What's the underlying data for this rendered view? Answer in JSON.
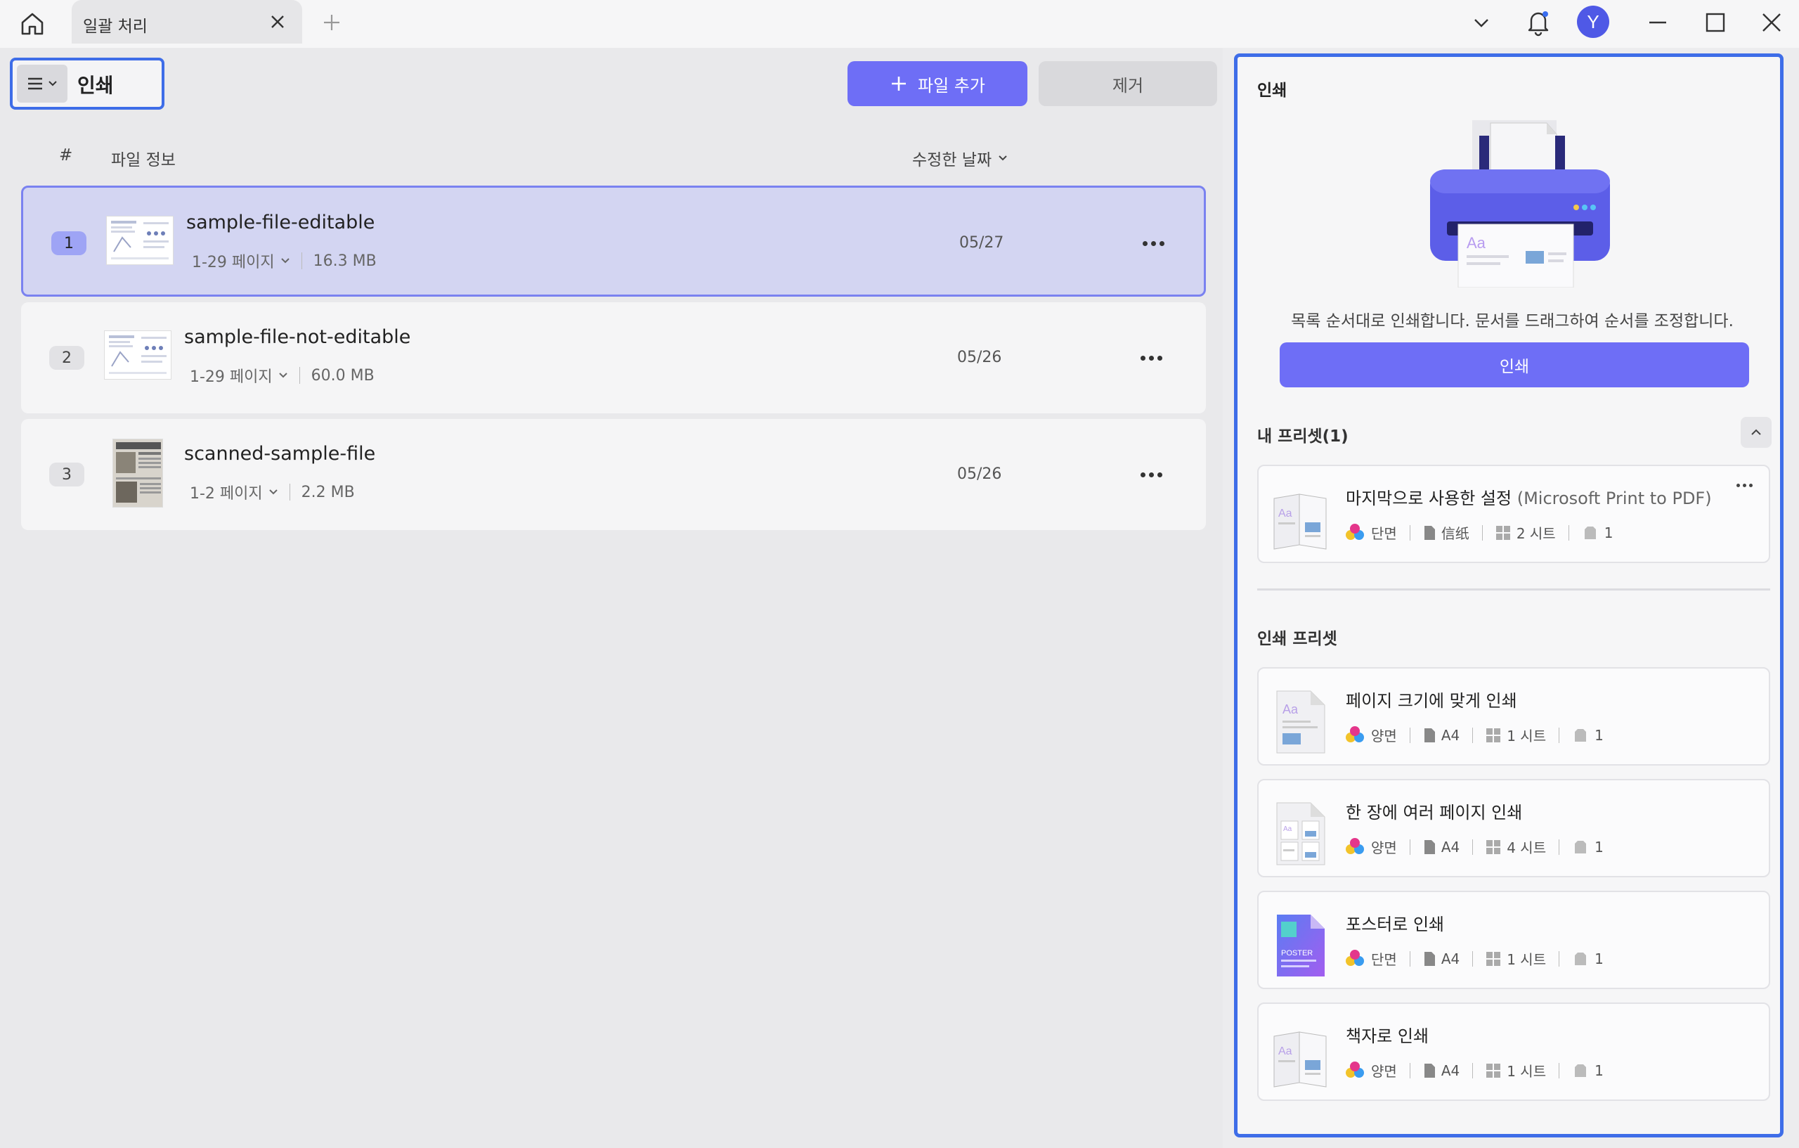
{
  "titlebar": {
    "tab_title": "일괄 처리",
    "avatar_letter": "Y"
  },
  "toolbar": {
    "mode_label": "인쇄",
    "add_file_label": "파일 추가",
    "remove_label": "제거"
  },
  "columns": {
    "number": "#",
    "file_info": "파일 정보",
    "modified_date": "수정한 날짜"
  },
  "files": [
    {
      "num": "1",
      "name": "sample-file-editable",
      "pages": "1-29 페이지",
      "size": "16.3 MB",
      "date": "05/27",
      "selected": true
    },
    {
      "num": "2",
      "name": "sample-file-not-editable",
      "pages": "1-29 페이지",
      "size": "60.0 MB",
      "date": "05/26",
      "selected": false
    },
    {
      "num": "3",
      "name": "scanned-sample-file",
      "pages": "1-2 페이지",
      "size": "2.2 MB",
      "date": "05/26",
      "selected": false
    }
  ],
  "print_panel": {
    "title": "인쇄",
    "description": "목록 순서대로 인쇄합니다. 문서를 드래그하여 순서를 조정합니다.",
    "print_button": "인쇄",
    "my_presets_label": "내 프리셋(1)",
    "print_presets_label": "인쇄 프리셋"
  },
  "my_presets": [
    {
      "title": "마지막으로 사용한 설정",
      "subtitle": "(Microsoft Print to PDF)",
      "sides": "단면",
      "paper": "信纸",
      "sheets": "2 시트",
      "copies": "1"
    }
  ],
  "print_presets": [
    {
      "title": "페이지 크기에 맞게 인쇄",
      "sides": "양면",
      "paper": "A4",
      "sheets": "1 시트",
      "copies": "1"
    },
    {
      "title": "한 장에 여러 페이지 인쇄",
      "sides": "양면",
      "paper": "A4",
      "sheets": "4 시트",
      "copies": "1"
    },
    {
      "title": "포스터로 인쇄",
      "sides": "단면",
      "paper": "A4",
      "sheets": "1 시트",
      "copies": "1",
      "icon_text": "POSTER"
    },
    {
      "title": "책자로 인쇄",
      "sides": "양면",
      "paper": "A4",
      "sheets": "1 시트",
      "copies": "1"
    }
  ],
  "printer_art": {
    "sample_text": "Aa"
  },
  "colors": {
    "accent": "#6e6ef6",
    "focus_border": "#3e6de8",
    "selected_row": "#d3d5f2"
  }
}
